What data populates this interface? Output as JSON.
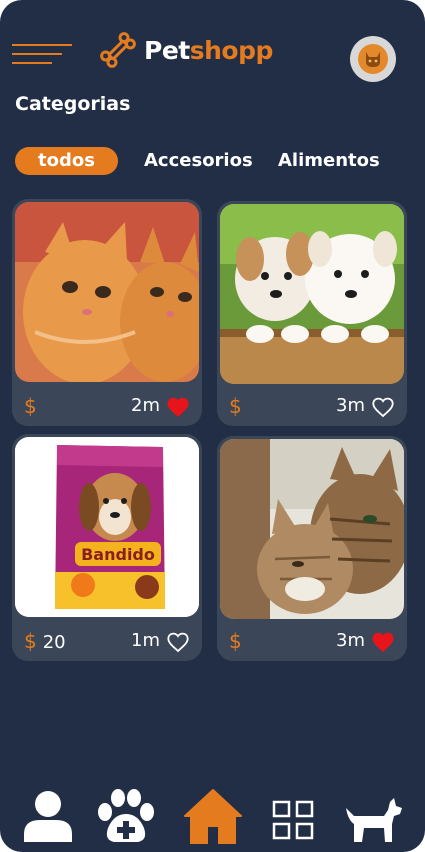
{
  "app": {
    "brand_part1": "Pet",
    "brand_part2": "shopp",
    "section_title": "Categorias"
  },
  "colors": {
    "background": "#212e45",
    "accent": "#e47b1f",
    "card": "#3b4658",
    "heart_red": "#e8141b"
  },
  "categories": [
    {
      "label": "todos",
      "active": true
    },
    {
      "label": "Accesorios",
      "active": false
    },
    {
      "label": "Alimentos",
      "active": false
    }
  ],
  "products": [
    {
      "image": "two orange kittens",
      "currency": "$",
      "price": "",
      "time": "2m",
      "liked": true
    },
    {
      "image": "two puppies in wooden box",
      "currency": "$",
      "price": "",
      "time": "3m",
      "liked": false
    },
    {
      "image": "Bandido dog food bag",
      "currency": "$",
      "price": "20",
      "time": "1m",
      "liked": false
    },
    {
      "image": "two tabby cats cuddling",
      "currency": "$",
      "price": "",
      "time": "3m",
      "liked": true
    }
  ],
  "bottom_nav": [
    {
      "icon": "user-icon",
      "active": false
    },
    {
      "icon": "paw-plus-icon",
      "active": false
    },
    {
      "icon": "home-icon",
      "active": true
    },
    {
      "icon": "grid-icon",
      "active": false
    },
    {
      "icon": "dog-icon",
      "active": false
    }
  ]
}
